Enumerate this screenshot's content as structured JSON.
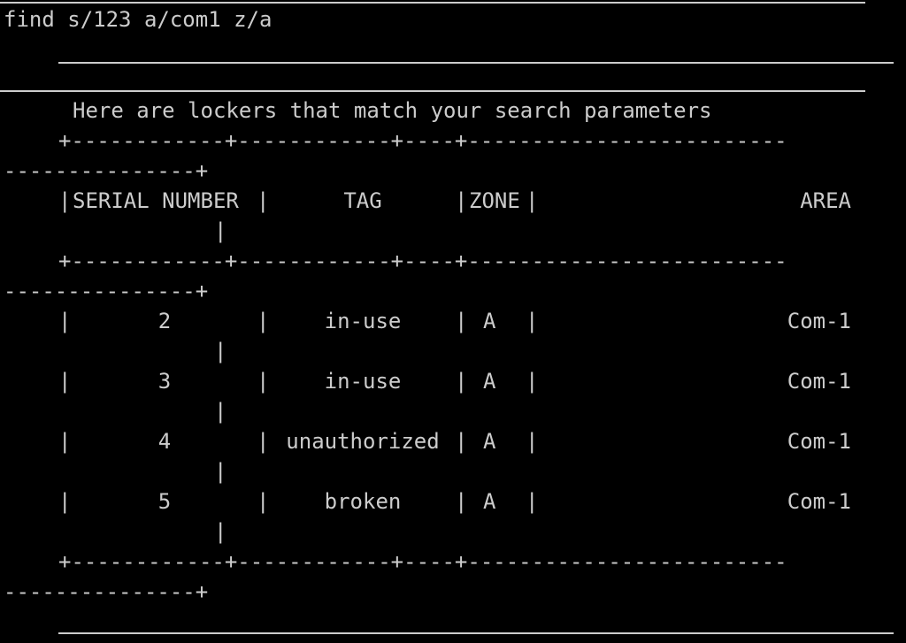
{
  "terminal": {
    "command": "find s/123 a/com1 z/a",
    "result_heading": "Here are lockers that match your search parameters",
    "table": {
      "border_top": "+------------+------------+----+-------------------------",
      "border_top_wrap": "---------------+",
      "headers": {
        "serial": "SERIAL NUMBER",
        "tag": "TAG",
        "zone": "ZONE",
        "area": "AREA"
      },
      "pipe": "|",
      "rows": [
        {
          "serial": "2",
          "tag": "in-use",
          "zone": "A",
          "area": "Com-1"
        },
        {
          "serial": "3",
          "tag": "in-use",
          "zone": "A",
          "area": "Com-1"
        },
        {
          "serial": "4",
          "tag": "unauthorized",
          "zone": "A",
          "area": "Com-1"
        },
        {
          "serial": "5",
          "tag": "broken",
          "zone": "A",
          "area": "Com-1"
        }
      ]
    }
  }
}
